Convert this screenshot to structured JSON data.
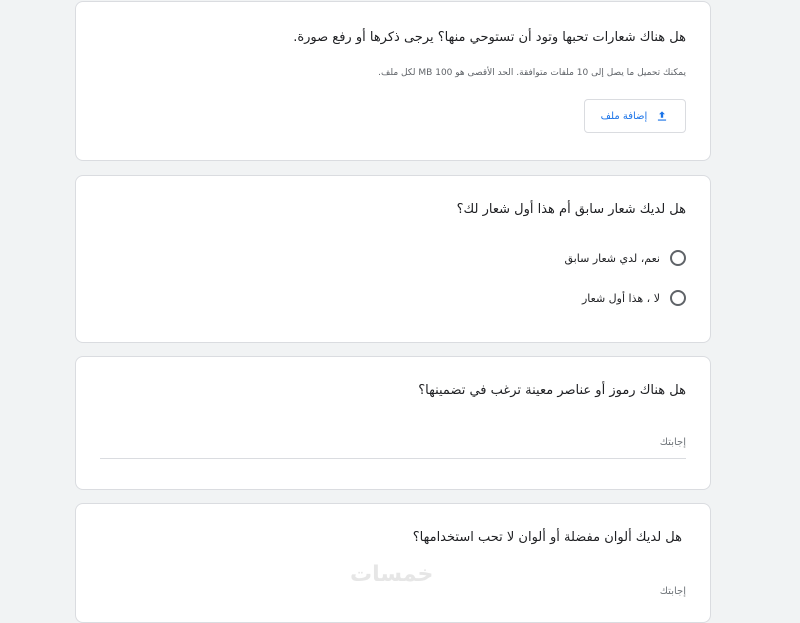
{
  "questions": [
    {
      "title": "هل هناك شعارات تحبها وتود أن تستوحي منها؟ يرجى ذكرها أو رفع صورة.",
      "hint": "يمكنك تحميل ما يصل إلى 10 ملفات متوافقة. الحد الأقصى هو 100 MB لكل ملف.",
      "upload_label": "إضافة ملف"
    },
    {
      "title": "هل لديك شعار سابق أم هذا أول شعار لك؟",
      "options": [
        "نعم، لدي شعار سابق",
        "لا ، هذا أول شعار"
      ]
    },
    {
      "title": "هل هناك رموز أو عناصر معينة ترغب في تضمينها؟",
      "answer_placeholder": "إجابتك"
    },
    {
      "title": "هل لديك ألوان مفضلة أو ألوان لا تحب استخدامها؟",
      "answer_placeholder": "إجابتك"
    }
  ],
  "watermark": "خمسات",
  "icons": {
    "upload": "upload-icon"
  },
  "colors": {
    "accent": "#1a73e8",
    "border": "#dadce0",
    "background": "#f1f3f4"
  }
}
